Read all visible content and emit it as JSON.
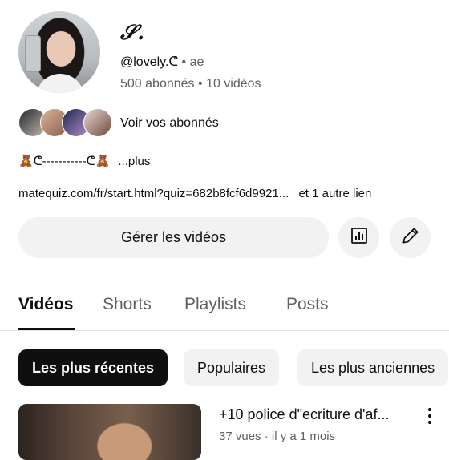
{
  "profile": {
    "channel_name": "𝒮.",
    "handle": "@lovely.ᕦ",
    "separator": "•",
    "country": "ae",
    "subscribers": "500 abonnés",
    "videos_count": "10 vidéos",
    "see_subscribers": "Voir vos abonnés",
    "bio": "🧸ᕦ-----------ᕦ🧸",
    "bio_more": "...plus",
    "link": "matequiz.com/fr/start.html?quiz=682b8fcf6d9921...",
    "other_links": "et 1 autre lien"
  },
  "actions": {
    "manage_videos": "Gérer les vidéos",
    "stats_icon": "bar-chart-icon",
    "edit_icon": "pencil-icon"
  },
  "tabs": [
    "Vidéos",
    "Shorts",
    "Playlists",
    "Posts"
  ],
  "chips": [
    "Les plus récentes",
    "Populaires",
    "Les plus anciennes"
  ],
  "video": {
    "title": "+10 police d\"ecriture d'af...",
    "meta": "37 vues · il y a 1 mois"
  },
  "colors": {
    "text_primary": "#0f0f0f",
    "text_secondary": "#606060",
    "chip_bg": "#f2f2f2",
    "active_chip_bg": "#0f0f0f"
  }
}
